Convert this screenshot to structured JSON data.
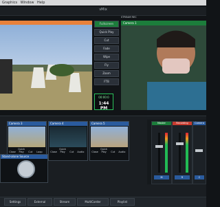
{
  "menubar": {
    "items": [
      "Graphics",
      "Window",
      "Help"
    ]
  },
  "window": {
    "title": "vMix"
  },
  "output": {
    "label": "Camera 1"
  },
  "transition": {
    "buttons": [
      "Fullscreen",
      "Quick Play",
      "Cut",
      "Fade",
      "Wipe",
      "Fly",
      "Zoom",
      "FTB"
    ],
    "active": "Fullscreen"
  },
  "status": {
    "stream": "STREAM",
    "rec": "REC"
  },
  "clock": {
    "elapsed": "00:00:0",
    "time": "1:44 PM"
  },
  "inputs": [
    {
      "number": "3",
      "name": "Camera 3",
      "buttons": [
        "Close",
        "Quick Play",
        "Cut",
        "Loop"
      ]
    },
    {
      "number": "4",
      "name": "Camera 4",
      "buttons": [
        "Close",
        "Quick Play",
        "Cut",
        "Audio"
      ]
    },
    {
      "number": "5",
      "name": "Camera 5",
      "buttons": [
        "Close",
        "Quick Play",
        "Cut",
        "Audio"
      ]
    }
  ],
  "ndi_input": {
    "number": "6",
    "name": "Stand-alone Source"
  },
  "mixer": {
    "strips": [
      {
        "label": "Master",
        "button": "M"
      },
      {
        "label": "Recording",
        "button": "R"
      },
      {
        "label": "Camera",
        "button": "C"
      }
    ],
    "side_label": "AUDIO MIX"
  },
  "bottom_bar": {
    "buttons": [
      "Settings",
      "External",
      "Stream",
      "MultiCorder",
      "Playlist"
    ]
  }
}
